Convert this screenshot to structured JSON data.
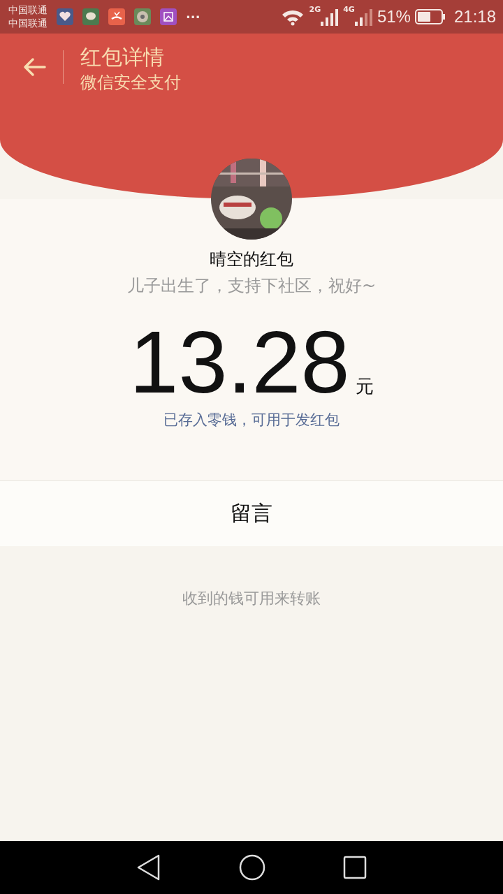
{
  "status_bar": {
    "carriers": [
      "中国联通",
      "中国联通"
    ],
    "more": "···",
    "network_1": "2G",
    "network_2": "4G",
    "battery": "51%",
    "time": "21:18"
  },
  "header": {
    "title": "红包详情",
    "subtitle": "微信安全支付"
  },
  "packet": {
    "sender": "晴空的红包",
    "message": "儿子出生了，支持下社区，祝好~",
    "amount": "13.28",
    "unit": "元",
    "note": "已存入零钱，可用于发红包"
  },
  "reply": {
    "label": "留言"
  },
  "footer_hint": "收到的钱可用来转账"
}
